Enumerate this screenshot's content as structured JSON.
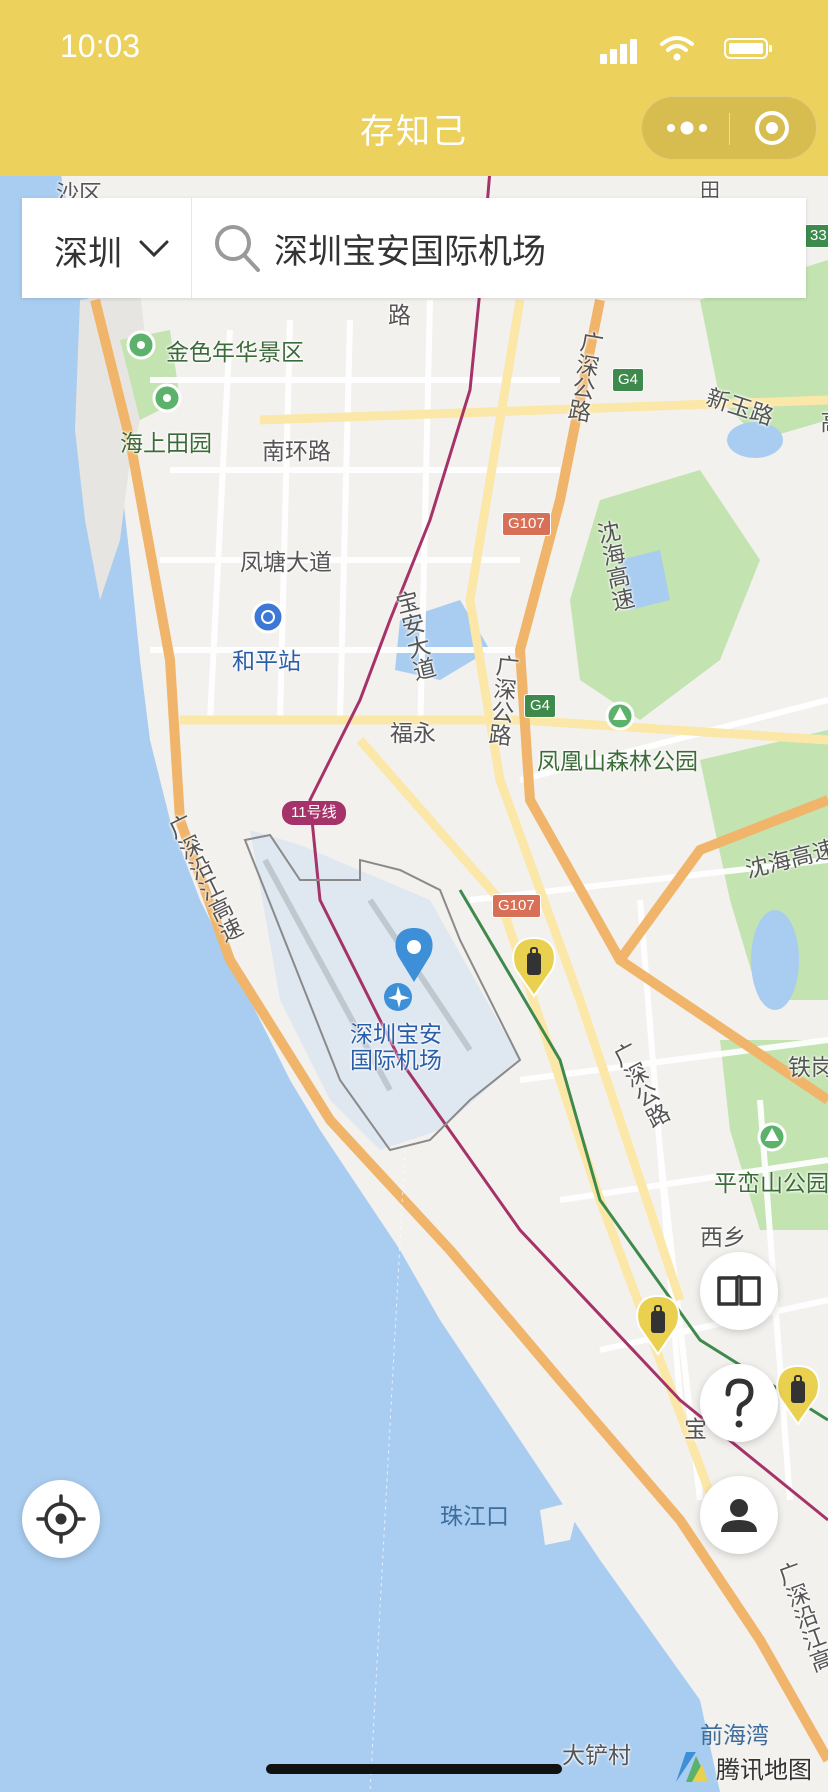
{
  "status": {
    "time": "10:03"
  },
  "app": {
    "title": "存知己"
  },
  "capsule": {
    "more_icon": "more-dots-icon",
    "close_icon": "target-close-icon"
  },
  "search": {
    "city": "深圳",
    "query": "深圳宝安国际机场",
    "icon": "search-icon"
  },
  "map": {
    "labels": {
      "shaqu": "沙区",
      "jinse": "金色年华景区",
      "haishang": "海上田园",
      "nanhuan": "南环路",
      "fengtang": "凤塘大道",
      "heping": "和平站",
      "baoan_dadao": "宝安大道",
      "fuyong": "福永",
      "guangshen1": "广深公路",
      "guangshen2": "广深公路",
      "guangshen3": "广深公路",
      "shenhai1": "沈海高速",
      "shenhai2": "沈海高速",
      "xinyu": "新玉路",
      "fenghuang": "凤凰山森林公园",
      "guangshen_coast": "广深沿江高速",
      "guangshen_coast2": "广深沿江高",
      "airport": "深圳宝安\n国际机场",
      "tiegang": "铁岗",
      "pingluan": "平峦山公园",
      "xixiang": "西乡",
      "bao": "宝",
      "zhujiangkou": "珠江口",
      "qianhai": "前海湾",
      "dachan": "大铲村",
      "lu": "路",
      "tian": "田",
      "gao": "高"
    },
    "shields": {
      "g4_a": "G4",
      "g4_b": "G4",
      "g107_a": "G107",
      "g107_b": "G107",
      "metro11": "11号线",
      "s33": "33"
    },
    "provider": "腾讯地图",
    "colors": {
      "land": "#f3f1ee",
      "water": "#a9cdf0",
      "green": "#c3e3b0",
      "highway": "#f5c374",
      "metro": "#a6326a",
      "rail": "#3e8a4c",
      "pin_blue": "#3d8fd8",
      "pin_yellow": "#ead04f"
    }
  },
  "buttons": {
    "locate_icon": "locate-icon",
    "book_icon": "book-icon",
    "help_icon": "question-icon",
    "user_icon": "user-icon"
  }
}
